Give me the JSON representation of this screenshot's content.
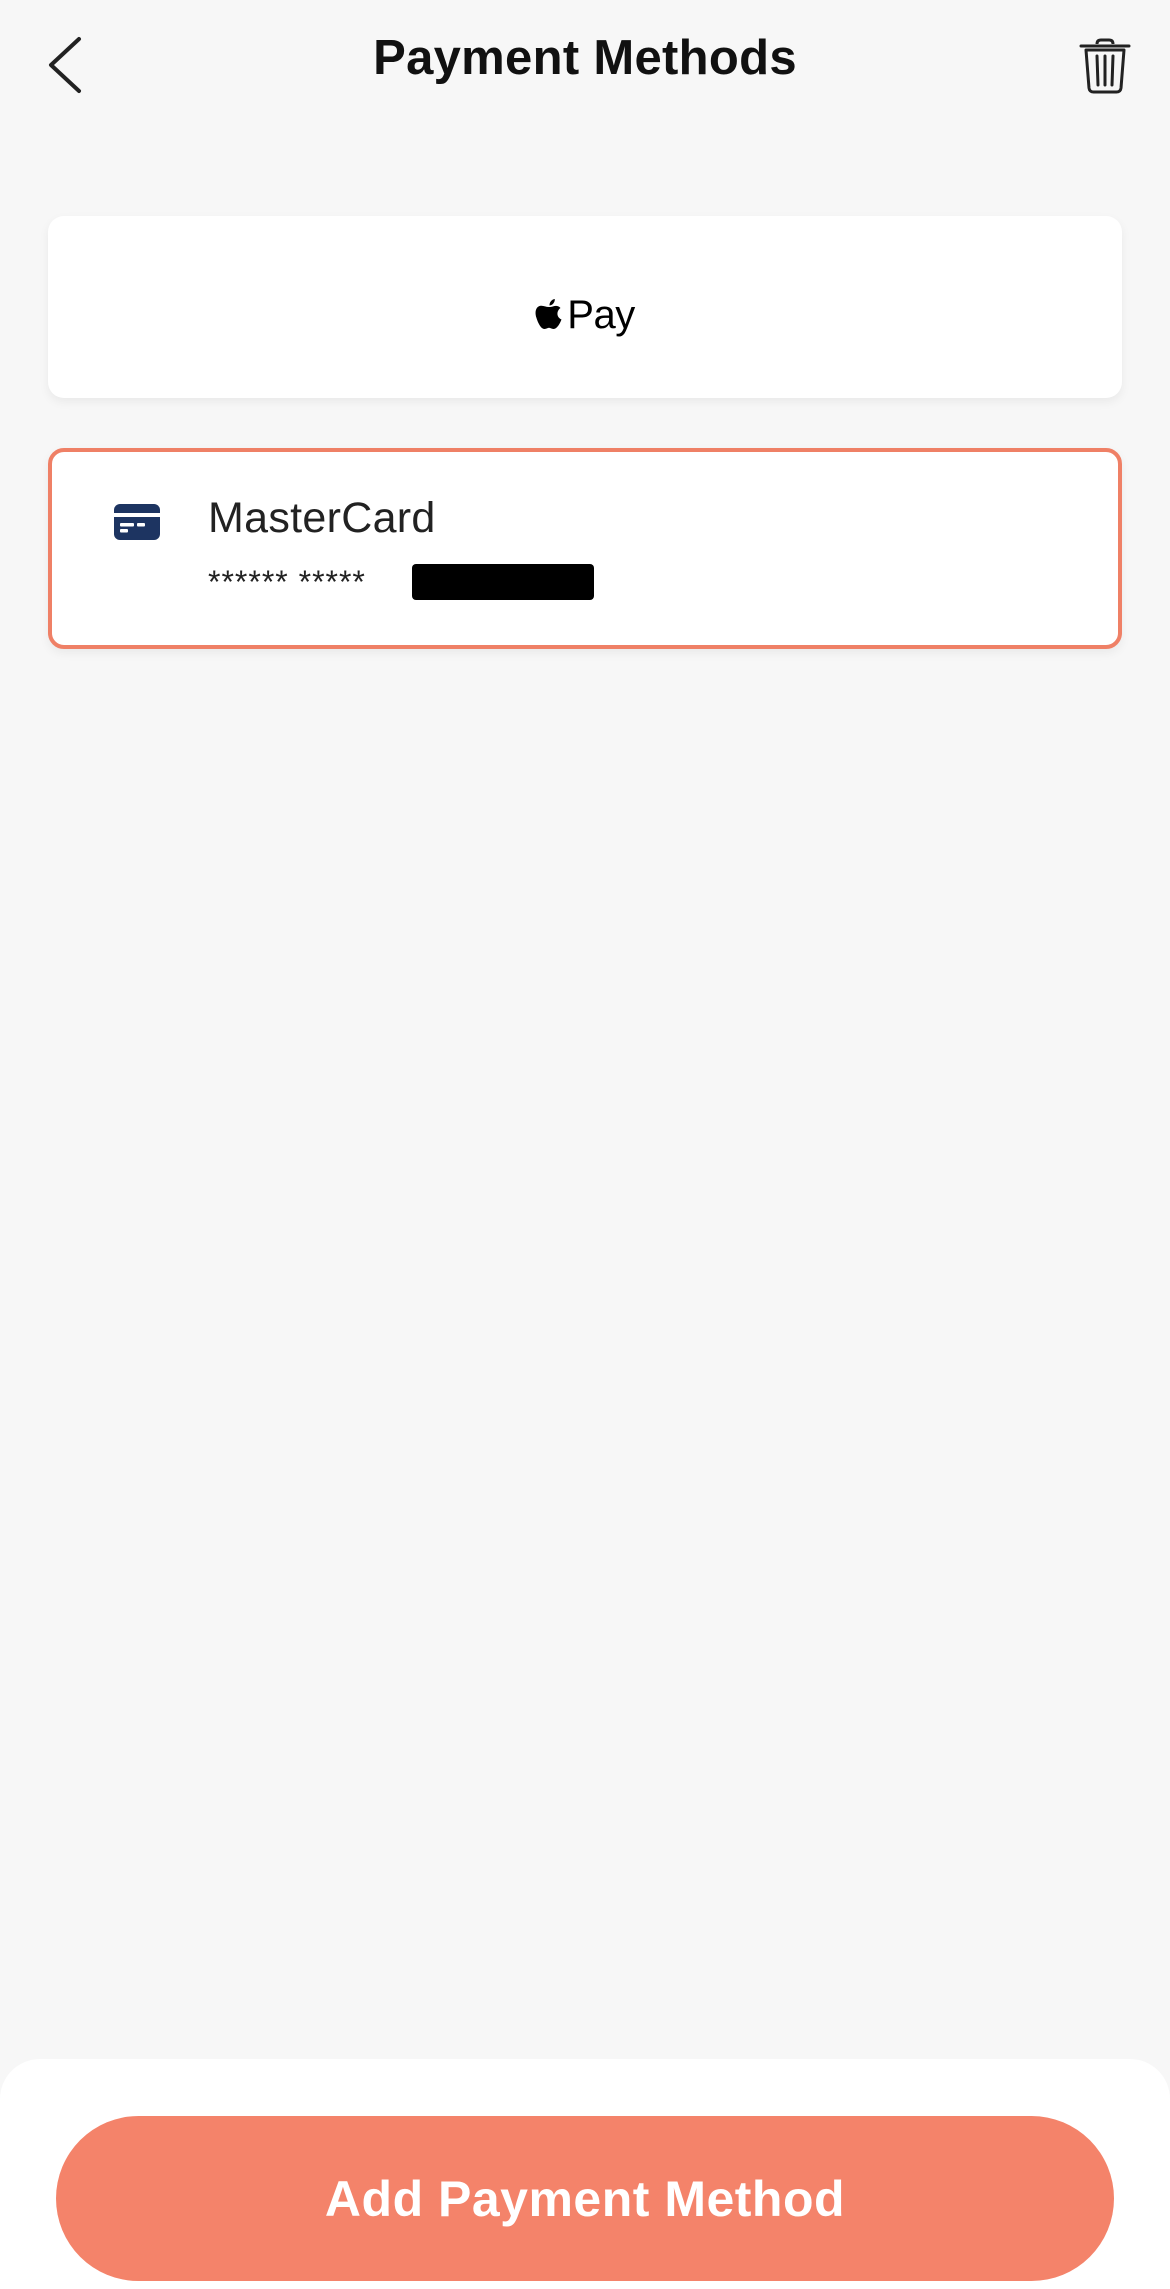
{
  "header": {
    "title": "Payment Methods",
    "back_icon": "chevron-left-icon",
    "trash_icon": "trash-icon"
  },
  "payment_methods": [
    {
      "type": "apple-pay",
      "label": "Pay",
      "icon": "apple-icon"
    },
    {
      "type": "card",
      "name": "MasterCard",
      "number_masked": "****** *****",
      "icon": "credit-card-icon",
      "selected": true
    }
  ],
  "footer": {
    "add_label": "Add Payment Method"
  },
  "colors": {
    "background": "#f7f7f7",
    "accent": "#f4836a",
    "selected_border": "#ef8066",
    "card_icon": "#1d3461"
  }
}
